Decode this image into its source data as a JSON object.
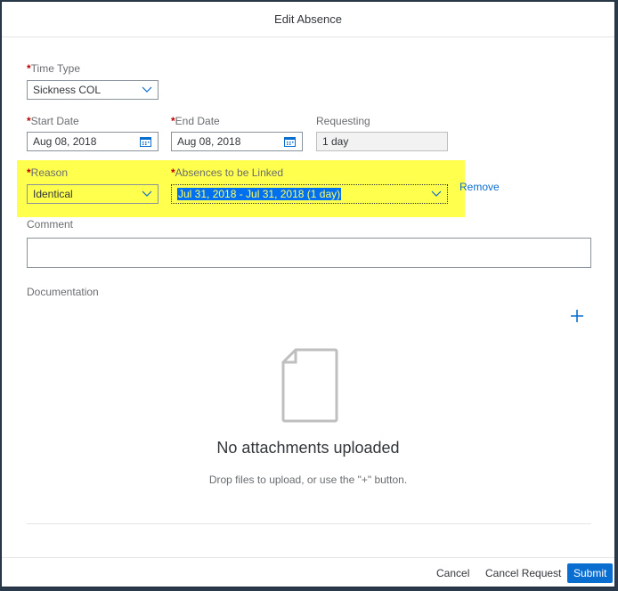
{
  "dialog": {
    "title": "Edit Absence"
  },
  "form": {
    "time_type": {
      "label": "Time Type",
      "value": "Sickness COL"
    },
    "start_date": {
      "label": "Start Date",
      "value": "Aug 08, 2018"
    },
    "end_date": {
      "label": "End Date",
      "value": "Aug 08, 2018"
    },
    "requesting": {
      "label": "Requesting",
      "value": "1 day"
    },
    "reason": {
      "label": "Reason",
      "value": "Identical"
    },
    "absences_linked": {
      "label": "Absences to be Linked",
      "value": "Jul 31, 2018 - Jul 31, 2018 (1 day)"
    },
    "remove_label": "Remove",
    "comment": {
      "label": "Comment",
      "value": ""
    },
    "documentation": {
      "label": "Documentation"
    },
    "required_marker": "*"
  },
  "attachments": {
    "empty_title": "No attachments uploaded",
    "empty_hint": "Drop files to upload, or use the \"+\" button."
  },
  "footer": {
    "cancel_label": "Cancel",
    "cancel_request_label": "Cancel Request",
    "submit_label": "Submit"
  },
  "colors": {
    "accent": "#0a6ed1",
    "highlight": "#ffff4d",
    "required": "#bb0000"
  },
  "icons": [
    "chevron-down-icon",
    "calendar-icon",
    "plus-icon",
    "document-icon"
  ]
}
